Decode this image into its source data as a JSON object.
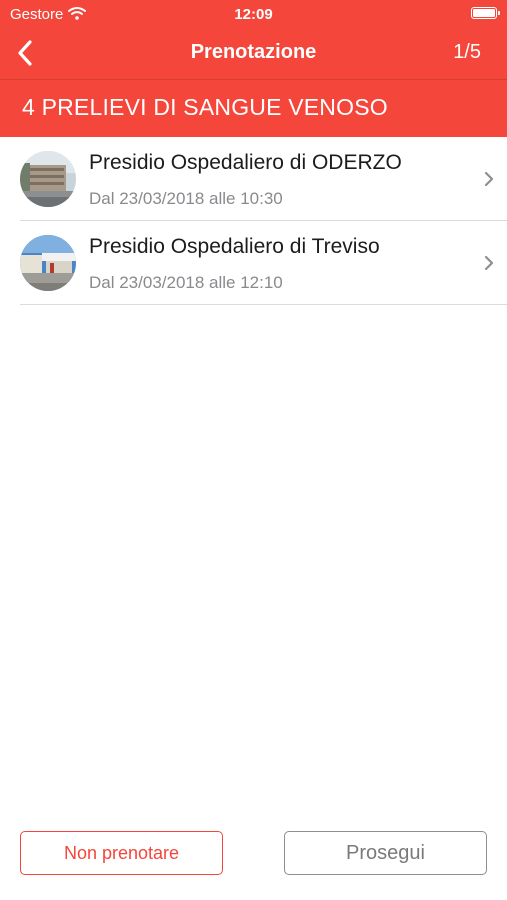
{
  "status_bar": {
    "carrier": "Gestore",
    "time": "12:09"
  },
  "nav": {
    "title": "Prenotazione",
    "step": "1/5"
  },
  "section": {
    "title": "4 PRELIEVI DI SANGUE VENOSO"
  },
  "locations": [
    {
      "name": "Presidio Ospedaliero di ODERZO",
      "availability": "Dal 23/03/2018 alle 10:30"
    },
    {
      "name": "Presidio Ospedaliero di Treviso",
      "availability": "Dal 23/03/2018 alle 12:10"
    }
  ],
  "actions": {
    "skip_label": "Non prenotare",
    "next_label": "Prosegui"
  },
  "colors": {
    "accent": "#f4463a",
    "secondary_text": "#8a8a8e",
    "separator": "#dcdcdc"
  }
}
